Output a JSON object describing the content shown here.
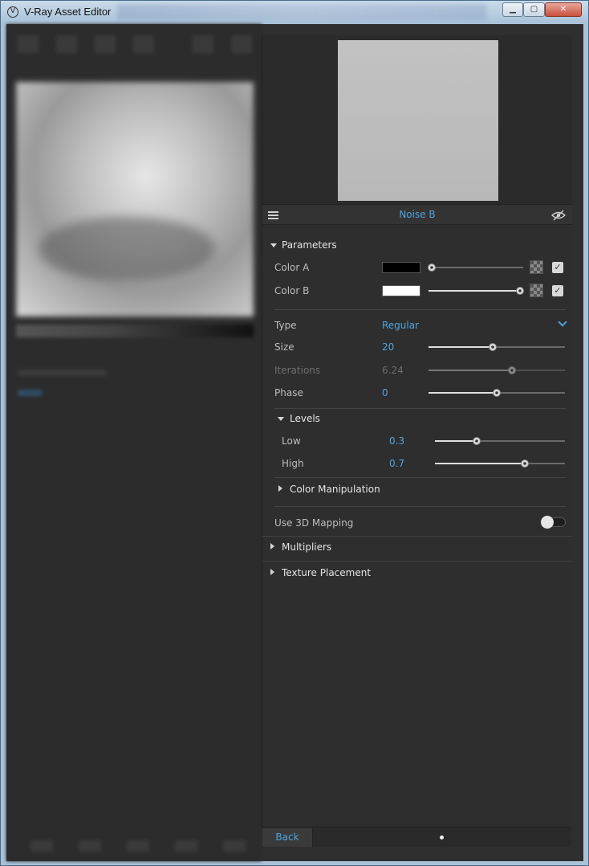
{
  "window": {
    "title": "V-Ray Asset Editor",
    "logo_glyph": "V",
    "minimize_glyph": "▁",
    "maximize_glyph": "▢",
    "close_glyph": "✕"
  },
  "header": {
    "title": "Noise B"
  },
  "parameters": {
    "section_label": "Parameters",
    "color_a": {
      "label": "Color A",
      "swatch": "#000000",
      "slider_fraction": 0.03,
      "checked": true
    },
    "color_b": {
      "label": "Color B",
      "swatch": "#ffffff",
      "slider_fraction": 0.97,
      "checked": true
    },
    "type": {
      "label": "Type",
      "value": "Regular"
    },
    "size": {
      "label": "Size",
      "value": "20",
      "slider_fraction": 0.47
    },
    "iterations": {
      "label": "Iterations",
      "value": "6.24",
      "slider_fraction": 0.61
    },
    "phase": {
      "label": "Phase",
      "value": "0",
      "slider_fraction": 0.5
    }
  },
  "levels": {
    "section_label": "Levels",
    "low": {
      "label": "Low",
      "value": "0.3",
      "slider_fraction": 0.32
    },
    "high": {
      "label": "High",
      "value": "0.7",
      "slider_fraction": 0.69
    }
  },
  "color_manipulation": {
    "section_label": "Color Manipulation"
  },
  "use_3d_mapping": {
    "label": "Use 3D Mapping",
    "enabled": false
  },
  "multipliers": {
    "section_label": "Multipliers"
  },
  "texture_placement": {
    "section_label": "Texture Placement"
  },
  "footer": {
    "back_label": "Back"
  },
  "icons": {
    "list": "list-icon",
    "eye": "eye-hidden-icon",
    "check": "✓"
  }
}
